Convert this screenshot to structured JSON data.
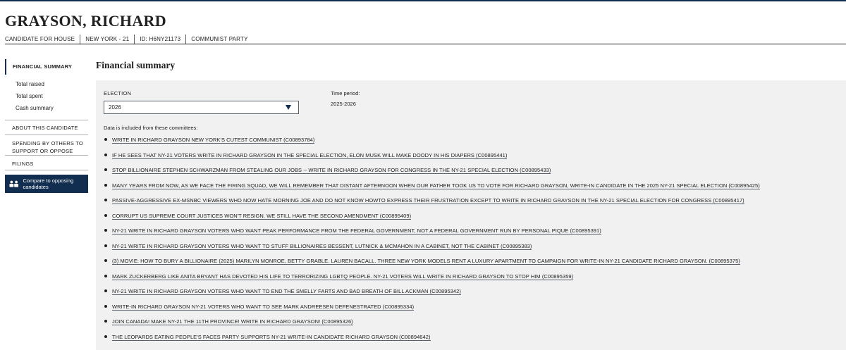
{
  "candidate": {
    "name": "GRAYSON, RICHARD",
    "office": "CANDIDATE FOR HOUSE",
    "district": "NEW YORK - 21",
    "id": "ID: H6NY21173",
    "party": "COMMUNIST PARTY"
  },
  "sidebar": {
    "active": "FINANCIAL SUMMARY",
    "sub_items": [
      "Total raised",
      "Total spent",
      "Cash summary"
    ],
    "about": "ABOUT THIS CANDIDATE",
    "spending": "SPENDING BY OTHERS TO SUPPORT OR OPPOSE",
    "filings": "FILINGS",
    "compare": "Compare to opposing candidates"
  },
  "main": {
    "title": "Financial summary",
    "election_label": "ELECTION",
    "election_value": "2026",
    "period_label": "Time period:",
    "period_value": "2025-2026",
    "included_label": "Data is included from these committees:",
    "committees": [
      "WRITE IN RICHARD GRAYSON NEW YORK'S CUTEST COMMUNIST (C00893784)",
      "IF HE SEES THAT NY-21 VOTERS WRITE IN RICHARD GRAYSON IN THE SPECIAL ELECTION, ELON MUSK WILL MAKE DOODY IN HIS DIAPERS (C00895441)",
      "STOP BILLIONAIRE STEPHEN SCHWARZMAN FROM STEALING OUR JOBS -- WRITE IN RICHARD GRAYSON FOR CONGRESS IN THE NY-21 SPECIAL ELECTION (C00895433)",
      "MANY YEARS FROM NOW, AS WE FACE THE FIRING SQUAD, WE WILL REMEMBER THAT DISTANT AFTERNOON WHEN OUR FATHER TOOK US TO VOTE FOR RICHARD GRAYSON, WRITE-IN CANDIDATE IN THE 2025 NY-21 SPECIAL ELECTION (C00895425)",
      "PASSIVE-AGGRESSIVE EX-MSNBC VIEWERS WHO NOW HATE MORNING JOE AND DO NOT KNOW HOWTO EXPRESS THEIR FRUSTRATION EXCEPT TO WRITE IN RICHARD GRAYSON IN THE NY-21 SPECIAL ELECTION FOR CONGRESS (C00895417)",
      "CORRUPT US SUPREME COURT JUSTICES WON'T RESIGN. WE STILL HAVE THE SECOND AMENDMENT (C00895409)",
      "NY-21 WRITE IN RICHARD GRAYSON VOTERS WHO WANT PEAK PERFORMANCE FROM THE FEDERAL GOVERNMENT, NOT A FEDERAL GOVERNMENT RUN BY PERSONAL PIQUE (C00895391)",
      "NY-21 WRITE IN RICHARD GRAYSON VOTERS WHO WANT TO STUFF BILLIONAIRES BESSENT, LUTNICK & MCMAHON IN A CABINET, NOT THE CABINET (C00895383)",
      "(3) MOVIE: HOW TO BURY A BILLIONAIRE (2025) MARILYN MONROE, BETTY GRABLE. LAUREN BACALL. THREE NEW YORK MODELS RENT A LUXURY APARTMENT TO CAMPAIGN FOR WRITE-IN NY-21 CANDIDATE RICHARD GRAYSON. (C00895375)",
      "MARK ZUCKERBERG LIKE ANITA BRYANT HAS DEVOTED HIS LIFE TO TERRORIZING LGBTQ PEOPLE. NY-21 VOTERS WILL WRITE IN RICHARD GRAYSON TO STOP HIM (C00895359)",
      "NY-21 WRITE IN RICHARD GRAYSON VOTERS WHO WANT TO END THE SMELLY FARTS AND BAD BREATH OF BILL ACKMAN (C00895342)",
      "WRITE-IN RICHARD GRAYSON NY-21 VOTERS WHO WANT TO SEE MARK ANDREESEN DEFENESTRATED (C00895334)",
      "JOIN CANADA! MAKE NY-21 THE 11TH PROVINCE! WRITE IN RICHARD GRAYSON! (C00895326)",
      "THE LEOPARDS EATING PEOPLE'S FACES PARTY SUPPORTS NY-21 WRITE-IN CANDIDATE RICHARD GRAYSON (C00894642)"
    ]
  },
  "colors": {
    "navy": "#112e51",
    "panel": "#f1f1f1"
  }
}
